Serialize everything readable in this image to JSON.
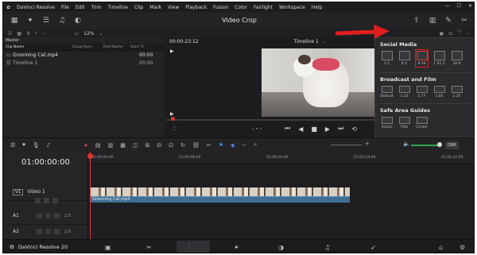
{
  "app": {
    "name": "DaVinci Resolve",
    "project_title": "Video Crop",
    "version_label": "DaVinci Resolve 20"
  },
  "menu": [
    "File",
    "Edit",
    "Trim",
    "Timeline",
    "Clip",
    "Mark",
    "View",
    "Playback",
    "Fusion",
    "Color",
    "Fairlight",
    "Workspace",
    "Help"
  ],
  "toolbar": {
    "zoom": "12%"
  },
  "media_pool": {
    "title": "Master",
    "columns": [
      "Clip Name",
      "Cloud Sync",
      "Reel Name",
      "Start TC"
    ],
    "rows": [
      {
        "name": "Grooming Cat.mp4",
        "start_tc": "00:00"
      },
      {
        "name": "Timeline 1",
        "start_tc": "00:00"
      }
    ]
  },
  "viewer": {
    "timecode": "00:00:23:12",
    "timeline_name": "Timeline 1"
  },
  "safe_area_menu": {
    "social_media": {
      "title": "Social Media",
      "options": [
        "1:1",
        "4:5",
        "9:16",
        "1.91:1",
        "16:9"
      ],
      "selected": "9:16"
    },
    "broadcast_film": {
      "title": "Broadcast and Film",
      "options": [
        "Default",
        "1.33",
        "1.77",
        "1.85",
        "2.35"
      ]
    },
    "safe_area_guides": {
      "title": "Safe Area Guides",
      "options": [
        "Action",
        "Title",
        "Center"
      ]
    }
  },
  "timeline": {
    "timecode": "01:00:00:00",
    "ruler_labels": [
      "01:00:00:00",
      "01:00:08:00",
      "01:00:16:00",
      "01:00:24:00",
      "01:00:32:00"
    ],
    "video_track": {
      "badge": "V1",
      "name": "Video 1"
    },
    "audio_tracks": [
      {
        "badge": "A1",
        "level": "2.0"
      },
      {
        "badge": "A2",
        "level": "2.0"
      }
    ],
    "clip_name": "Grooming Cat.mp4",
    "dim_label": "DIM"
  },
  "colors": {
    "playhead": "#e53030",
    "selection": "#e01e1e",
    "audio_clip": "#3e6f93",
    "arrow": "#e01e1e"
  }
}
